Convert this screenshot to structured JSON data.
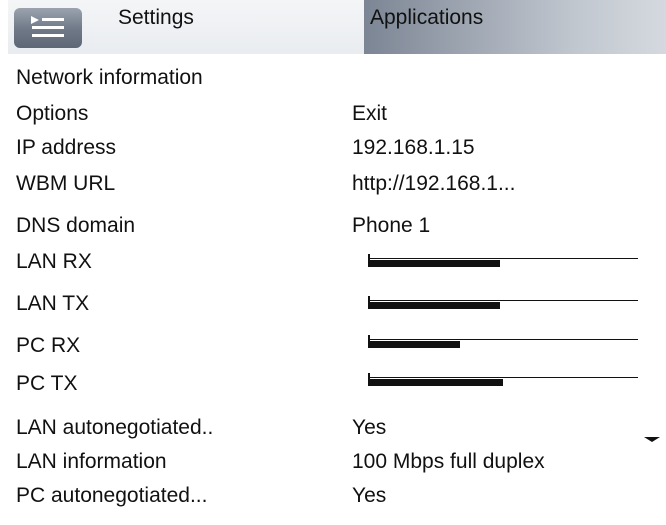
{
  "tabs": [
    {
      "label": "Settings",
      "active": true
    },
    {
      "label": "Applications",
      "active": false
    }
  ],
  "menu_button": {
    "icon": "menu-icon"
  },
  "page": {
    "title": "Network information"
  },
  "rows": [
    {
      "label": "Options",
      "value": "Exit"
    },
    {
      "label": "IP address",
      "value": "192.168.1.15"
    },
    {
      "label": "WBM URL",
      "value": "http://192.168.1..."
    },
    {
      "label": "DNS domain",
      "value": "Phone 1"
    },
    {
      "label": "LAN RX",
      "meter": 0.49
    },
    {
      "label": "LAN TX",
      "meter": 0.49
    },
    {
      "label": "PC RX",
      "meter": 0.34
    },
    {
      "label": "PC TX",
      "meter": 0.5
    },
    {
      "label": "LAN autonegotiated..",
      "value": "Yes"
    },
    {
      "label": "LAN information",
      "value": "100 Mbps full duplex"
    },
    {
      "label": "PC autonegotiated...",
      "value": "Yes"
    }
  ],
  "scroll_indicator": {
    "icon": "scroll-down-icon"
  },
  "colors": {
    "tab_active": "#eef0f3",
    "tab_inactive": "#9aa2ae",
    "meter": "#111111"
  }
}
